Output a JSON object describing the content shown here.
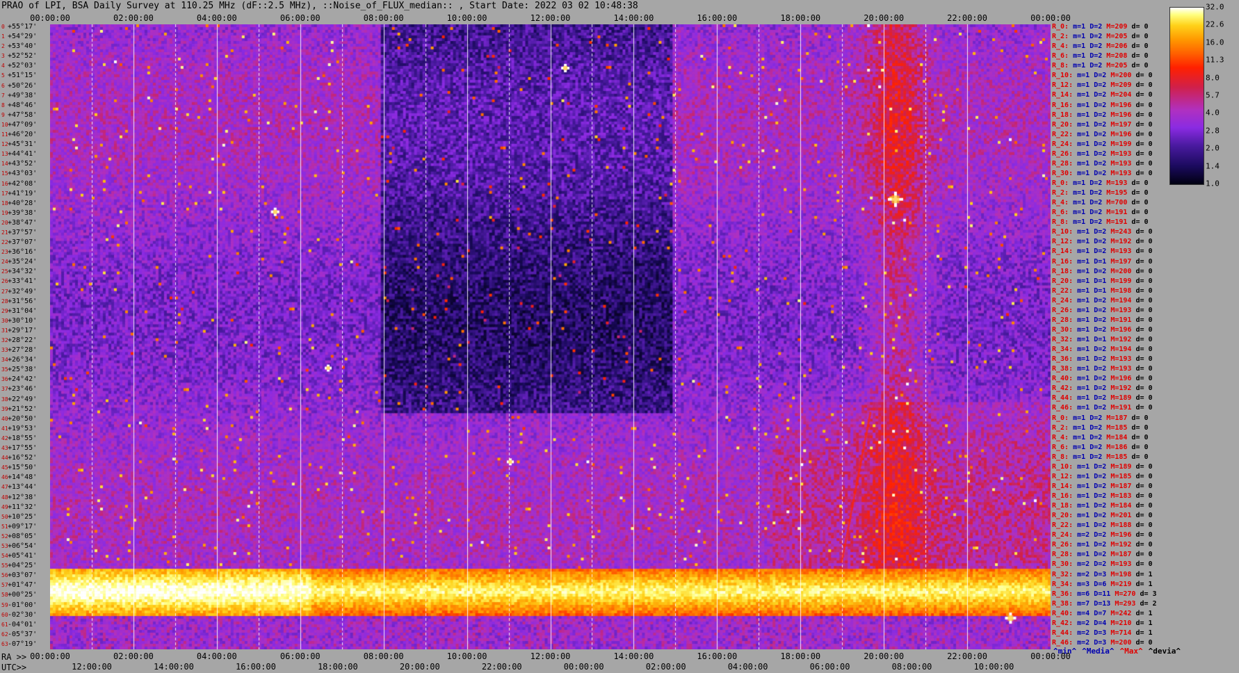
{
  "title": "PRAO of LPI, BSA Daily Survey at 110.25 MHz (dF::2.5 MHz), ::Noise_of_FLUX_median:: , Start Date: 2022 03 02 10:48:38",
  "chart_data": {
    "type": "heatmap",
    "title": "PRAO of LPI, BSA Daily Survey at 110.25 MHz (dF::2.5 MHz), ::Noise_of_FLUX_median:: , Start Date: 2022 03 02 10:48:38",
    "top_axis_ticks": [
      "00:00:00",
      "02:00:00",
      "04:00:00",
      "06:00:00",
      "08:00:00",
      "10:00:00",
      "12:00:00",
      "14:00:00",
      "16:00:00",
      "18:00:00",
      "20:00:00",
      "22:00:00",
      "00:00:00"
    ],
    "ra_label": "RA >>",
    "ra_ticks": [
      "00:00:00",
      "02:00:00",
      "04:00:00",
      "06:00:00",
      "08:00:00",
      "10:00:00",
      "12:00:00",
      "14:00:00",
      "16:00:00",
      "18:00:00",
      "20:00:00",
      "22:00:00",
      "00:00:00"
    ],
    "utc_label": "UTC>>",
    "utc_ticks": [
      "12:00:00",
      "14:00:00",
      "16:00:00",
      "18:00:00",
      "20:00:00",
      "22:00:00",
      "00:00:00",
      "02:00:00",
      "04:00:00",
      "06:00:00",
      "08:00:00",
      "10:00:00"
    ],
    "declinations": [
      "+55°17'",
      "+54°29'",
      "+53°40'",
      "+52°52'",
      "+52°03'",
      "+51°15'",
      "+50°26'",
      "+49°38'",
      "+48°46'",
      "+47°58'",
      "+47°09'",
      "+46°20'",
      "+45°31'",
      "+44°41'",
      "+43°52'",
      "+43°03'",
      "+42°08'",
      "+41°19'",
      "+40°28'",
      "+39°38'",
      "+38°47'",
      "+37°57'",
      "+37°07'",
      "+36°16'",
      "+35°24'",
      "+34°32'",
      "+33°41'",
      "+32°49'",
      "+31°56'",
      "+31°04'",
      "+30°10'",
      "+29°17'",
      "+28°22'",
      "+27°28'",
      "+26°34'",
      "+25°38'",
      "+24°42'",
      "+23°46'",
      "+22°49'",
      "+21°52'",
      "+20°50'",
      "+19°53'",
      "+18°55'",
      "+17°55'",
      "+16°52'",
      "+15°50'",
      "+14°48'",
      "+13°44'",
      "+12°38'",
      "+11°32'",
      "+10°25'",
      "+09°17'",
      "+08°05'",
      "+06°54'",
      "+05°41'",
      "+04°25'",
      "+03°07'",
      "+01°47'",
      "+00°25'",
      "-01°00'",
      "-02°30'",
      "-04°01'",
      "-05°37'",
      "-07°19'"
    ],
    "stats": [
      {
        "r": "R_0:",
        "m": "1",
        "D": "2",
        "M": "209",
        "d": "0"
      },
      {
        "r": "R_2:",
        "m": "1",
        "D": "2",
        "M": "205",
        "d": "0"
      },
      {
        "r": "R_4:",
        "m": "1",
        "D": "2",
        "M": "206",
        "d": "0"
      },
      {
        "r": "R_6:",
        "m": "1",
        "D": "2",
        "M": "208",
        "d": "0"
      },
      {
        "r": "R_8:",
        "m": "1",
        "D": "2",
        "M": "205",
        "d": "0"
      },
      {
        "r": "R_10:",
        "m": "1",
        "D": "2",
        "M": "200",
        "d": "0"
      },
      {
        "r": "R_12:",
        "m": "1",
        "D": "2",
        "M": "209",
        "d": "0"
      },
      {
        "r": "R_14:",
        "m": "1",
        "D": "2",
        "M": "204",
        "d": "0"
      },
      {
        "r": "R_16:",
        "m": "1",
        "D": "2",
        "M": "196",
        "d": "0"
      },
      {
        "r": "R_18:",
        "m": "1",
        "D": "2",
        "M": "196",
        "d": "0"
      },
      {
        "r": "R_20:",
        "m": "1",
        "D": "2",
        "M": "197",
        "d": "0"
      },
      {
        "r": "R_22:",
        "m": "1",
        "D": "2",
        "M": "196",
        "d": "0"
      },
      {
        "r": "R_24:",
        "m": "1",
        "D": "2",
        "M": "199",
        "d": "0"
      },
      {
        "r": "R_26:",
        "m": "1",
        "D": "2",
        "M": "193",
        "d": "0"
      },
      {
        "r": "R_28:",
        "m": "1",
        "D": "2",
        "M": "193",
        "d": "0"
      },
      {
        "r": "R_30:",
        "m": "1",
        "D": "2",
        "M": "193",
        "d": "0"
      },
      {
        "r": "R_0:",
        "m": "1",
        "D": "2",
        "M": "193",
        "d": "0"
      },
      {
        "r": "R_2:",
        "m": "1",
        "D": "2",
        "M": "195",
        "d": "0"
      },
      {
        "r": "R_4:",
        "m": "1",
        "D": "2",
        "M": "700",
        "d": "0"
      },
      {
        "r": "R_6:",
        "m": "1",
        "D": "2",
        "M": "191",
        "d": "0"
      },
      {
        "r": "R_8:",
        "m": "1",
        "D": "2",
        "M": "191",
        "d": "0"
      },
      {
        "r": "R_10:",
        "m": "1",
        "D": "2",
        "M": "243",
        "d": "0"
      },
      {
        "r": "R_12:",
        "m": "1",
        "D": "2",
        "M": "192",
        "d": "0"
      },
      {
        "r": "R_14:",
        "m": "1",
        "D": "2",
        "M": "193",
        "d": "0"
      },
      {
        "r": "R_16:",
        "m": "1",
        "D": "1",
        "M": "197",
        "d": "0"
      },
      {
        "r": "R_18:",
        "m": "1",
        "D": "2",
        "M": "200",
        "d": "0"
      },
      {
        "r": "R_20:",
        "m": "1",
        "D": "1",
        "M": "199",
        "d": "0"
      },
      {
        "r": "R_22:",
        "m": "1",
        "D": "1",
        "M": "198",
        "d": "0"
      },
      {
        "r": "R_24:",
        "m": "1",
        "D": "2",
        "M": "194",
        "d": "0"
      },
      {
        "r": "R_26:",
        "m": "1",
        "D": "2",
        "M": "193",
        "d": "0"
      },
      {
        "r": "R_28:",
        "m": "1",
        "D": "2",
        "M": "191",
        "d": "0"
      },
      {
        "r": "R_30:",
        "m": "1",
        "D": "2",
        "M": "196",
        "d": "0"
      },
      {
        "r": "R_32:",
        "m": "1",
        "D": "1",
        "M": "192",
        "d": "0"
      },
      {
        "r": "R_34:",
        "m": "1",
        "D": "2",
        "M": "194",
        "d": "0"
      },
      {
        "r": "R_36:",
        "m": "1",
        "D": "2",
        "M": "193",
        "d": "0"
      },
      {
        "r": "R_38:",
        "m": "1",
        "D": "2",
        "M": "193",
        "d": "0"
      },
      {
        "r": "R_40:",
        "m": "1",
        "D": "2",
        "M": "196",
        "d": "0"
      },
      {
        "r": "R_42:",
        "m": "1",
        "D": "2",
        "M": "192",
        "d": "0"
      },
      {
        "r": "R_44:",
        "m": "1",
        "D": "2",
        "M": "189",
        "d": "0"
      },
      {
        "r": "R_46:",
        "m": "1",
        "D": "2",
        "M": "191",
        "d": "0"
      },
      {
        "r": "R_0:",
        "m": "1",
        "D": "2",
        "M": "187",
        "d": "0"
      },
      {
        "r": "R_2:",
        "m": "1",
        "D": "2",
        "M": "185",
        "d": "0"
      },
      {
        "r": "R_4:",
        "m": "1",
        "D": "2",
        "M": "184",
        "d": "0"
      },
      {
        "r": "R_6:",
        "m": "1",
        "D": "2",
        "M": "186",
        "d": "0"
      },
      {
        "r": "R_8:",
        "m": "1",
        "D": "2",
        "M": "185",
        "d": "0"
      },
      {
        "r": "R_10:",
        "m": "1",
        "D": "2",
        "M": "189",
        "d": "0"
      },
      {
        "r": "R_12:",
        "m": "1",
        "D": "2",
        "M": "185",
        "d": "0"
      },
      {
        "r": "R_14:",
        "m": "1",
        "D": "2",
        "M": "187",
        "d": "0"
      },
      {
        "r": "R_16:",
        "m": "1",
        "D": "2",
        "M": "183",
        "d": "0"
      },
      {
        "r": "R_18:",
        "m": "1",
        "D": "2",
        "M": "184",
        "d": "0"
      },
      {
        "r": "R_20:",
        "m": "1",
        "D": "2",
        "M": "201",
        "d": "0"
      },
      {
        "r": "R_22:",
        "m": "1",
        "D": "2",
        "M": "188",
        "d": "0"
      },
      {
        "r": "R_24:",
        "m": "2",
        "D": "2",
        "M": "196",
        "d": "0"
      },
      {
        "r": "R_26:",
        "m": "1",
        "D": "2",
        "M": "192",
        "d": "0"
      },
      {
        "r": "R_28:",
        "m": "1",
        "D": "2",
        "M": "187",
        "d": "0"
      },
      {
        "r": "R_30:",
        "m": "2",
        "D": "2",
        "M": "193",
        "d": "0"
      },
      {
        "r": "R_32:",
        "m": "2",
        "D": "3",
        "M": "198",
        "d": "1"
      },
      {
        "r": "R_34:",
        "m": "3",
        "D": "6",
        "M": "219",
        "d": "1"
      },
      {
        "r": "R_36:",
        "m": "6",
        "D": "11",
        "M": "270",
        "d": "3"
      },
      {
        "r": "R_38:",
        "m": "7",
        "D": "13",
        "M": "293",
        "d": "2"
      },
      {
        "r": "R_40:",
        "m": "4",
        "D": "7",
        "M": "242",
        "d": "1"
      },
      {
        "r": "R_42:",
        "m": "2",
        "D": "4",
        "M": "210",
        "d": "1"
      },
      {
        "r": "R_44:",
        "m": "2",
        "D": "3",
        "M": "714",
        "d": "1"
      },
      {
        "r": "R_46:",
        "m": "2",
        "D": "3",
        "M": "200",
        "d": "0"
      }
    ],
    "legend_keys": [
      "^min^",
      "^Media^",
      "^Max^",
      "^devia^"
    ],
    "colorbar_ticks": [
      "32.0",
      "22.6",
      "16.0",
      "11.3",
      "8.0",
      "5.7",
      "4.0",
      "2.8",
      "2.0",
      "1.4",
      "1.0"
    ],
    "colorbar_scale": "log",
    "colormap": [
      "#000010",
      "#1a0a5c",
      "#4a1aa0",
      "#8a2be2",
      "#b030c0",
      "#d0204a",
      "#ff2000",
      "#ff6000",
      "#ff9900",
      "#ffd21a",
      "#ffff80",
      "#ffffff"
    ],
    "sun_band": {
      "dec_from": "+01°47'",
      "dec_to": "-02°30'"
    },
    "bright_sources_ra": [
      "05:20:00",
      "08:30:00",
      "09:30:00",
      "12:30:00",
      "20:00:00",
      "23:20:00"
    ]
  },
  "colors": {
    "label_red": "#e00000",
    "label_blue": "#0000b0",
    "background": "#a6a6a6"
  }
}
